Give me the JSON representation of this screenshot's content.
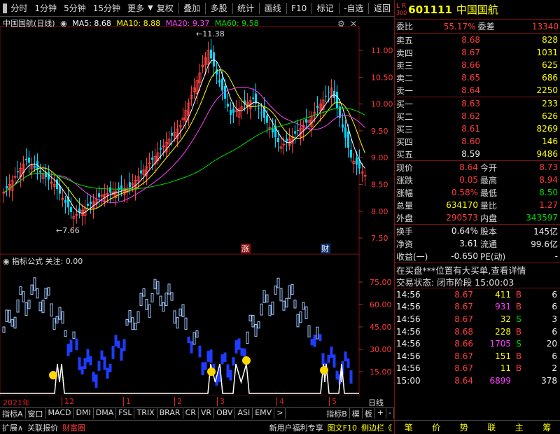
{
  "toolbar": {
    "items": [
      "分时",
      "1分钟",
      "5分钟",
      "15分钟",
      "更多"
    ],
    "right_items": [
      "复权",
      "叠加",
      "多股",
      "统计",
      "画线",
      "F10",
      "标记",
      "-自选",
      "返回"
    ]
  },
  "chart_title": {
    "name": "中国国航(日线)",
    "ma5": "MA5: 8.68",
    "ma10": "MA10: 8.88",
    "ma20": "MA20: 9.37",
    "ma60": "MA60: 9.58"
  },
  "indicator_title": "指标公式 关注: 0.00",
  "price_ticks": [
    "11.00",
    "10.50",
    "10.00",
    "9.50",
    "9.00",
    "8.50",
    "8.00",
    "7.50"
  ],
  "ind_ticks": [
    "75.00",
    "60.00",
    "45.00",
    "30.00",
    "15.00"
  ],
  "annotations": {
    "high": "11.38",
    "low": "7.66",
    "zhang": "涨",
    "cai": "财"
  },
  "dates": [
    "2021年",
    "12",
    "1",
    "2",
    "3",
    "4",
    "5"
  ],
  "period_label": "日线",
  "tabs": [
    "指标A",
    "窗口",
    "MACD",
    "DMI",
    "DMA",
    "FSL",
    "TRIX",
    "BRAR",
    "CR",
    "VR",
    "OBV",
    "ASI",
    "EMV",
    ">",
    "指标B",
    "模",
    "板",
    "+",
    "-"
  ],
  "bottom": [
    "扩展∧",
    "关联报价",
    "财富圈"
  ],
  "bottom_right": [
    "新用户福利专享",
    "图文F10",
    "侧边栏《"
  ],
  "stock": {
    "lr": "L R",
    "sub": "300",
    "code": "601111",
    "name": "中国国航"
  },
  "weibi": {
    "label": "委比",
    "value": "55.17%",
    "label2": "委差",
    "value2": "13340"
  },
  "asks": [
    {
      "label": "卖五",
      "price": "8.68",
      "vol": "828"
    },
    {
      "label": "卖四",
      "price": "8.67",
      "vol": "1031"
    },
    {
      "label": "卖三",
      "price": "8.66",
      "vol": "625"
    },
    {
      "label": "卖二",
      "price": "8.65",
      "vol": "686"
    },
    {
      "label": "卖一",
      "price": "8.64",
      "vol": "2250"
    }
  ],
  "bids": [
    {
      "label": "买一",
      "price": "8.63",
      "vol": "233"
    },
    {
      "label": "买二",
      "price": "8.62",
      "vol": "626"
    },
    {
      "label": "买三",
      "price": "8.61",
      "vol": "8269"
    },
    {
      "label": "买四",
      "price": "8.60",
      "vol": "146"
    },
    {
      "label": "买五",
      "price": "8.59",
      "vol": "9486"
    }
  ],
  "quote": [
    {
      "l1": "现价",
      "v1": "8.64",
      "l2": "今开",
      "v2": "8.73"
    },
    {
      "l1": "涨跌",
      "v1": "0.05",
      "l2": "最高",
      "v2": "8.94"
    },
    {
      "l1": "涨幅",
      "v1": "0.58%",
      "l2": "最低",
      "v2": "8.50"
    },
    {
      "l1": "总量",
      "v1": "634170",
      "l2": "量比",
      "v2": "1.27"
    },
    {
      "l1": "外盘",
      "v1": "290573",
      "l2": "内盘",
      "v2": "343597"
    }
  ],
  "fund": [
    {
      "l1": "换手",
      "v1": "0.64%",
      "l2": "股本",
      "v2": "145亿"
    },
    {
      "l1": "净资",
      "v1": "3.61",
      "l2": "流通",
      "v2": "99.6亿"
    },
    {
      "l1": "收益(一)",
      "v1": "-0.650",
      "l2": "PE(动)",
      "v2": "-"
    }
  ],
  "notice": "在买盘***位置有大买单,查看详情",
  "status": "交易状态: 闭市阶段 15:00:03",
  "ticks": [
    {
      "t": "14:56",
      "p": "8.67",
      "v": "411",
      "d": "B",
      "n": "6"
    },
    {
      "t": "14:56",
      "p": "8.67",
      "v": "931",
      "d": "B",
      "n": "6"
    },
    {
      "t": "14:56",
      "p": "8.67",
      "v": "32",
      "d": "S",
      "n": "3"
    },
    {
      "t": "14:56",
      "p": "8.68",
      "v": "228",
      "d": "B",
      "n": "6"
    },
    {
      "t": "14:56",
      "p": "8.66",
      "v": "1705",
      "d": "S",
      "n": "20"
    },
    {
      "t": "14:56",
      "p": "8.67",
      "v": "151",
      "d": "B",
      "n": "6"
    },
    {
      "t": "14:56",
      "p": "8.67",
      "v": "11",
      "d": "B",
      "n": "2"
    },
    {
      "t": "15:00",
      "p": "8.64",
      "v": "6899",
      "d": "",
      "n": "378"
    }
  ],
  "right_bottom": [
    "笔",
    "价",
    "势",
    "联",
    "主",
    "筹"
  ]
}
